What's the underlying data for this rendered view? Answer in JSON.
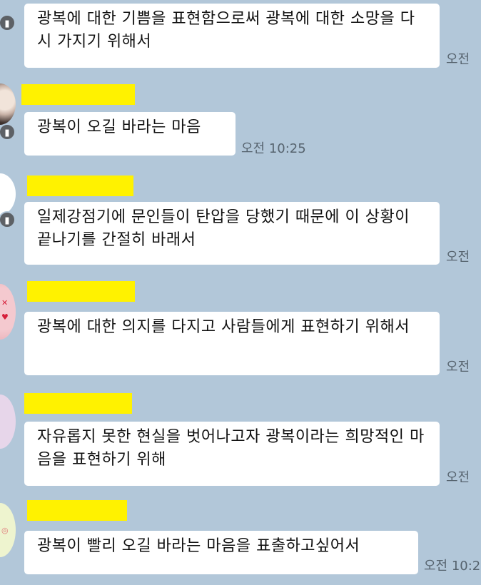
{
  "colors": {
    "background": "#b2c7d9",
    "bubble": "#ffffff",
    "name_highlight": "#fff200",
    "timestamp": "#56636e"
  },
  "messages": [
    {
      "text": "광복에 대한 기쁨을 표현함으로써 광복에 대한 소망을 다시 가지기 위해서",
      "time": "오전"
    },
    {
      "text": "광복이 오길 바라는 마음",
      "time": "오전 10:25"
    },
    {
      "text": "일제강점기에 문인들이 탄압을 당했기 때문에 이 상황이 끝나기를 간절히 바래서",
      "time": "오전"
    },
    {
      "text": "광복에 대한 의지를 다지고 사람들에게 표현하기 위해서",
      "time": "오전"
    },
    {
      "text": "자유롭지 못한 현실을 벗어나고자 광복이라는 희망적인 마음을 표현하기 위해",
      "time": "오전"
    },
    {
      "text": "광복이 빨리 오길 바라는 마음을 표출하고싶어서",
      "time": "오전 10:2"
    }
  ],
  "badge_icon": "chat-badge-icon"
}
